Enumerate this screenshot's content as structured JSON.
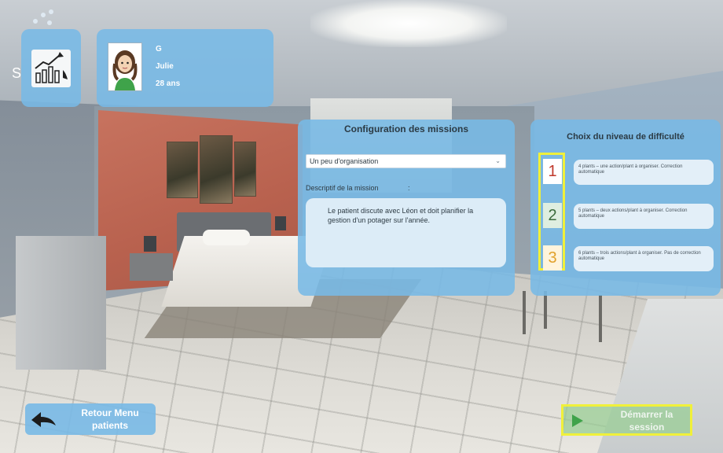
{
  "header": {
    "stats_icon": "chart-trend-icon",
    "side_letter": "S"
  },
  "patient": {
    "initial": "G",
    "name": "Julie",
    "age": "28 ans",
    "avatar": "female-avatar-icon"
  },
  "mission": {
    "title": "Configuration des missions",
    "selected": "Un peu d'organisation",
    "desc_label": "Descriptif de la mission",
    "desc_colon": ":",
    "description": "Le patient discute avec Léon et doit planifier la gestion d'un potager sur l'année."
  },
  "difficulty": {
    "title": "Choix du niveau de difficulté",
    "levels": [
      {
        "num": "1",
        "color": "#c0392b",
        "desc": "4 plants – une action/plant à organiser. Correction automatique"
      },
      {
        "num": "2",
        "color": "#3b6b3b",
        "desc": "5 plants – deux actions/plant à organiser. Correction automatique"
      },
      {
        "num": "3",
        "color": "#e1a12a",
        "desc": "6 plants – trois actions/plant à organiser. Pas de correction automatique"
      }
    ]
  },
  "footer": {
    "back_label_1": "Retour Menu",
    "back_label_2": "patients",
    "start_label_1": "Démarrer la",
    "start_label_2": "session"
  },
  "colors": {
    "panel": "#78b9e6",
    "highlight": "#f0f03a",
    "play": "#3fa34a"
  }
}
